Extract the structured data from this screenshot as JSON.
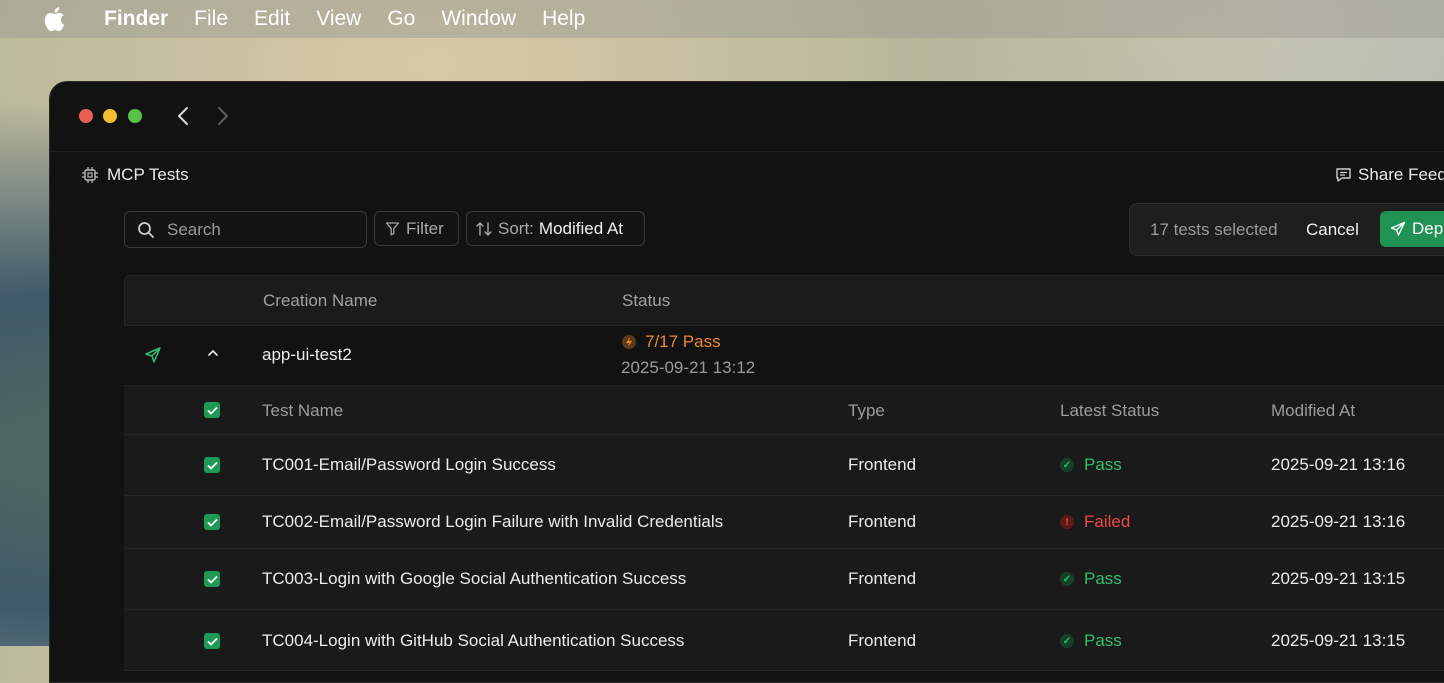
{
  "menubar": {
    "app": "Finder",
    "items": [
      "File",
      "Edit",
      "View",
      "Go",
      "Window",
      "Help"
    ]
  },
  "window": {
    "title": "MCP Tests",
    "share_label": "Share Feed"
  },
  "toolbar": {
    "search_placeholder": "Search",
    "filter_label": "Filter",
    "sort_label": "Sort:",
    "sort_value": "Modified At"
  },
  "selection": {
    "count_text": "17 tests selected",
    "cancel_label": "Cancel",
    "deploy_label": "Dep"
  },
  "table": {
    "headers": {
      "name": "Creation Name",
      "status": "Status"
    },
    "group": {
      "name": "app-ui-test2",
      "status": "7/17 Pass",
      "date": "2025-09-21 13:12"
    },
    "sub_headers": {
      "test_name": "Test Name",
      "type": "Type",
      "latest_status": "Latest Status",
      "modified_at": "Modified At"
    },
    "rows": [
      {
        "name": "TC001-Email/Password Login Success",
        "type": "Frontend",
        "status": "Pass",
        "modified": "2025-09-21 13:16"
      },
      {
        "name": "TC002-Email/Password Login Failure with Invalid Credentials",
        "type": "Frontend",
        "status": "Failed",
        "modified": "2025-09-21 13:16"
      },
      {
        "name": "TC003-Login with Google Social Authentication Success",
        "type": "Frontend",
        "status": "Pass",
        "modified": "2025-09-21 13:15"
      },
      {
        "name": "TC004-Login with GitHub Social Authentication Success",
        "type": "Frontend",
        "status": "Pass",
        "modified": "2025-09-21 13:15"
      }
    ]
  },
  "colors": {
    "accent_green": "#1f9254",
    "pass": "#2fbf6f",
    "failed": "#ef4747",
    "warning": "#e8892d"
  }
}
